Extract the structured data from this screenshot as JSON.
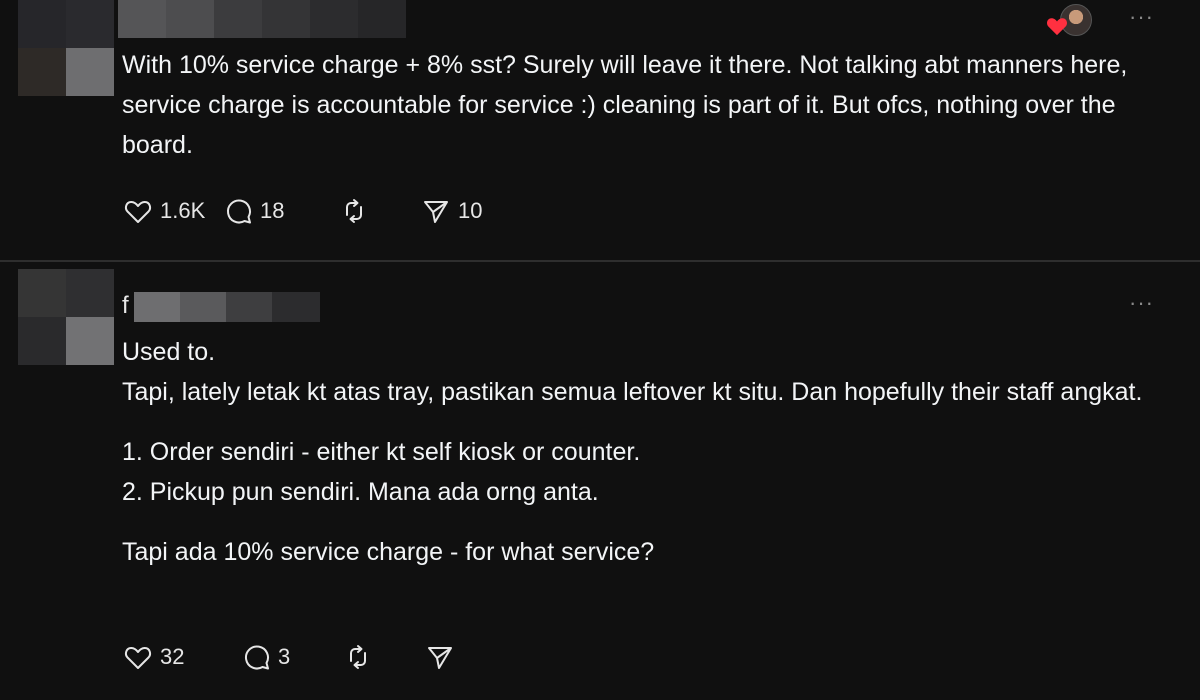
{
  "posts": [
    {
      "text": [
        "With 10% service charge + 8% sst? Surely will leave it there. Not talking abt manners here, service charge is accountable for service :) cleaning is part of it. But ofcs, nothing over the board."
      ],
      "actions": {
        "likes": "1.6K",
        "replies": "18",
        "reposts": "",
        "shares": "10"
      }
    },
    {
      "name_initial": "f",
      "text": [
        "Used to.",
        "Tapi, lately letak kt atas tray, pastikan semua leftover kt situ. Dan hopefully their staff angkat.",
        "",
        "1. Order sendiri - either kt self kiosk or counter.",
        "2. Pickup pun sendiri. Mana ada orng anta.",
        "",
        "Tapi ada 10% service charge - for what service?"
      ],
      "actions": {
        "likes": "32",
        "replies": "3",
        "reposts": "",
        "shares": ""
      }
    }
  ],
  "icons": {
    "more": "more-options-icon",
    "like": "heart-icon",
    "reply": "comment-icon",
    "repost": "repost-icon",
    "share": "share-icon"
  },
  "colors": {
    "background": "#101010",
    "text": "#f3f5f7",
    "muted": "#8a8a8a",
    "heart": "#ff3040",
    "divider": "#2e2e2e"
  }
}
